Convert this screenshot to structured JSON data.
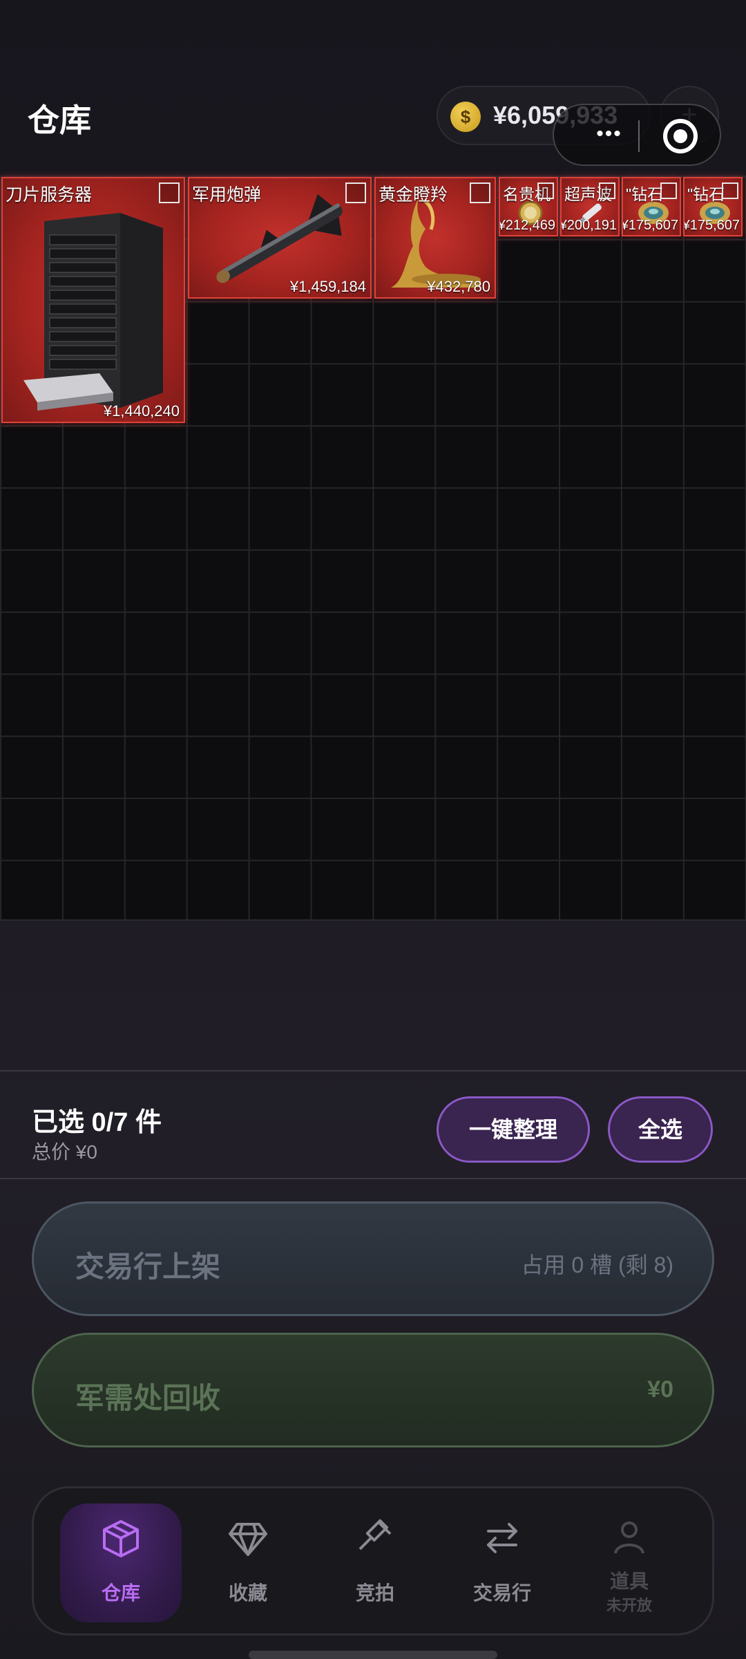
{
  "header": {
    "title": "仓库",
    "balance": "¥6,059,933",
    "coin_symbol": "$",
    "plus_label": "+",
    "more_label": "•••"
  },
  "items": [
    {
      "name": "刀片服务器",
      "price": "¥1,440,240"
    },
    {
      "name": "军用炮弹",
      "price": "¥1,459,184"
    },
    {
      "name": "黄金瞪羚",
      "price": "¥432,780"
    },
    {
      "name": "名贵机",
      "price": "¥212,469"
    },
    {
      "name": "超声波",
      "price": "¥200,191"
    },
    {
      "name": "\"钻石",
      "price": "¥175,607"
    },
    {
      "name": "\"钻石",
      "price": "¥175,607"
    }
  ],
  "selection": {
    "count_label": "已选 0/7 件",
    "total_label": "总价  ¥0",
    "organize_label": "一键整理",
    "select_all_label": "全选"
  },
  "actions": {
    "market_label": "交易行上架",
    "market_slots": "占用 0 槽 (剩 8)",
    "recycle_label": "军需处回收",
    "recycle_value": "¥0"
  },
  "nav": {
    "items": [
      {
        "label": "仓库",
        "icon": "box-icon",
        "active": true
      },
      {
        "label": "收藏",
        "icon": "diamond-icon"
      },
      {
        "label": "竞拍",
        "icon": "gavel-icon"
      },
      {
        "label": "交易行",
        "icon": "swap-icon"
      },
      {
        "label": "道具",
        "sub": "未开放",
        "icon": "user-icon",
        "disabled": true
      }
    ]
  },
  "colors": {
    "rarity_red": "#a52420",
    "accent_purple": "#b86df2",
    "coin_gold": "#e0b83a"
  }
}
